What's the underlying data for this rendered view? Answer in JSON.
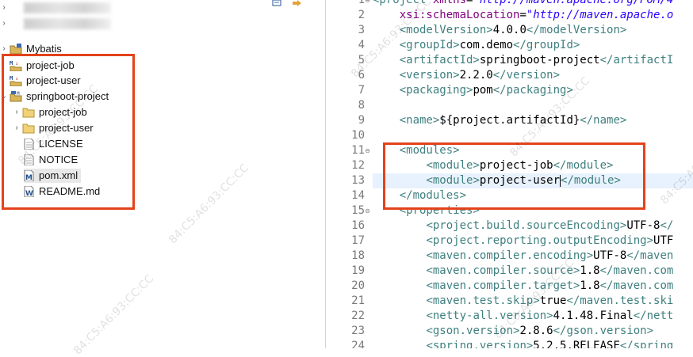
{
  "tree": {
    "items": [
      {
        "label": "",
        "kind": "blurred"
      },
      {
        "label": "",
        "kind": "blurred"
      },
      {
        "label": "Mybatis",
        "kind": "project"
      },
      {
        "label": "project-job",
        "kind": "maven-module"
      },
      {
        "label": "project-user",
        "kind": "maven-module"
      },
      {
        "label": "springboot-project",
        "kind": "maven-project"
      },
      {
        "label": "project-job",
        "kind": "folder"
      },
      {
        "label": "project-user",
        "kind": "folder"
      },
      {
        "label": "LICENSE",
        "kind": "file"
      },
      {
        "label": "NOTICE",
        "kind": "file"
      },
      {
        "label": "pom.xml",
        "kind": "pom-file"
      },
      {
        "label": "README.md",
        "kind": "md-file"
      }
    ]
  },
  "editor": {
    "line_numbers": [
      "1",
      "2",
      "3",
      "4",
      "5",
      "6",
      "7",
      "8",
      "9",
      "10",
      "11",
      "12",
      "13",
      "14",
      "15",
      "16",
      "17",
      "18",
      "19",
      "20",
      "21",
      "22",
      "23",
      "24"
    ],
    "lines": [
      [
        [
          "tag",
          "<project "
        ],
        [
          "attr",
          "xmlns"
        ],
        [
          "txt",
          "="
        ],
        [
          "str",
          "\"http://maven.apache.org/POM/4"
        ]
      ],
      [
        [
          "txt",
          "    "
        ],
        [
          "attr",
          "xsi:schemaLocation"
        ],
        [
          "txt",
          "="
        ],
        [
          "str",
          "\"http://maven.apache.o"
        ]
      ],
      [
        [
          "txt",
          "    "
        ],
        [
          "tag",
          "<modelVersion>"
        ],
        [
          "txt",
          "4.0.0"
        ],
        [
          "tag",
          "</modelVersion>"
        ]
      ],
      [
        [
          "txt",
          "    "
        ],
        [
          "tag",
          "<groupId>"
        ],
        [
          "txt",
          "com.demo"
        ],
        [
          "tag",
          "</groupId>"
        ]
      ],
      [
        [
          "txt",
          "    "
        ],
        [
          "tag",
          "<artifactId>"
        ],
        [
          "txt",
          "springboot-project"
        ],
        [
          "tag",
          "</artifactI"
        ]
      ],
      [
        [
          "txt",
          "    "
        ],
        [
          "tag",
          "<version>"
        ],
        [
          "txt",
          "2.2.0"
        ],
        [
          "tag",
          "</version>"
        ]
      ],
      [
        [
          "txt",
          "    "
        ],
        [
          "tag",
          "<packaging>"
        ],
        [
          "txt",
          "pom"
        ],
        [
          "tag",
          "</packaging>"
        ]
      ],
      [],
      [
        [
          "txt",
          "    "
        ],
        [
          "tag",
          "<name>"
        ],
        [
          "txt",
          "${project.artifactId}"
        ],
        [
          "tag",
          "</name>"
        ]
      ],
      [],
      [
        [
          "txt",
          "    "
        ],
        [
          "tag",
          "<modules>"
        ]
      ],
      [
        [
          "txt",
          "        "
        ],
        [
          "tag",
          "<module>"
        ],
        [
          "txt",
          "project-job"
        ],
        [
          "tag",
          "</module>"
        ]
      ],
      [
        [
          "txt",
          "        "
        ],
        [
          "tag",
          "<module>"
        ],
        [
          "txt",
          "project-user"
        ],
        [
          "caret",
          ""
        ],
        [
          "tag",
          "</module>"
        ]
      ],
      [
        [
          "txt",
          "    "
        ],
        [
          "tag",
          "</modules>"
        ]
      ],
      [
        [
          "txt",
          "    "
        ],
        [
          "tag",
          "<properties>"
        ]
      ],
      [
        [
          "txt",
          "        "
        ],
        [
          "tag",
          "<project.build.sourceEncoding>"
        ],
        [
          "txt",
          "UTF-8"
        ],
        [
          "tag",
          "</"
        ]
      ],
      [
        [
          "txt",
          "        "
        ],
        [
          "tag",
          "<project.reporting.outputEncoding>"
        ],
        [
          "txt",
          "UTF"
        ]
      ],
      [
        [
          "txt",
          "        "
        ],
        [
          "tag",
          "<maven.compiler.encoding>"
        ],
        [
          "txt",
          "UTF-8"
        ],
        [
          "tag",
          "</maven"
        ]
      ],
      [
        [
          "txt",
          "        "
        ],
        [
          "tag",
          "<maven.compiler.source>"
        ],
        [
          "txt",
          "1.8"
        ],
        [
          "tag",
          "</maven.com"
        ]
      ],
      [
        [
          "txt",
          "        "
        ],
        [
          "tag",
          "<maven.compiler.target>"
        ],
        [
          "txt",
          "1.8"
        ],
        [
          "tag",
          "</maven.com"
        ]
      ],
      [
        [
          "txt",
          "        "
        ],
        [
          "tag",
          "<maven.test.skip>"
        ],
        [
          "txt",
          "true"
        ],
        [
          "tag",
          "</maven.test.ski"
        ]
      ],
      [
        [
          "txt",
          "        "
        ],
        [
          "tag",
          "<netty-all.version>"
        ],
        [
          "txt",
          "4.1.48.Final"
        ],
        [
          "tag",
          "</nett"
        ]
      ],
      [
        [
          "txt",
          "        "
        ],
        [
          "tag",
          "<gson.version>"
        ],
        [
          "txt",
          "2.8.6"
        ],
        [
          "tag",
          "</gson.version>"
        ]
      ],
      [
        [
          "txt",
          "        "
        ],
        [
          "tag",
          "<spring.version>"
        ],
        [
          "txt",
          "5.2.5.RELEASE"
        ],
        [
          "tag",
          "</spring"
        ]
      ]
    ],
    "current_line": 13
  },
  "watermark": "84:C5:A6:93:CC:CC",
  "colors": {
    "annotation": "#e4421b",
    "tag": "#3f7f7f",
    "attr": "#7f007f",
    "string": "#2a00ff",
    "current_line": "#e8f2fe"
  }
}
